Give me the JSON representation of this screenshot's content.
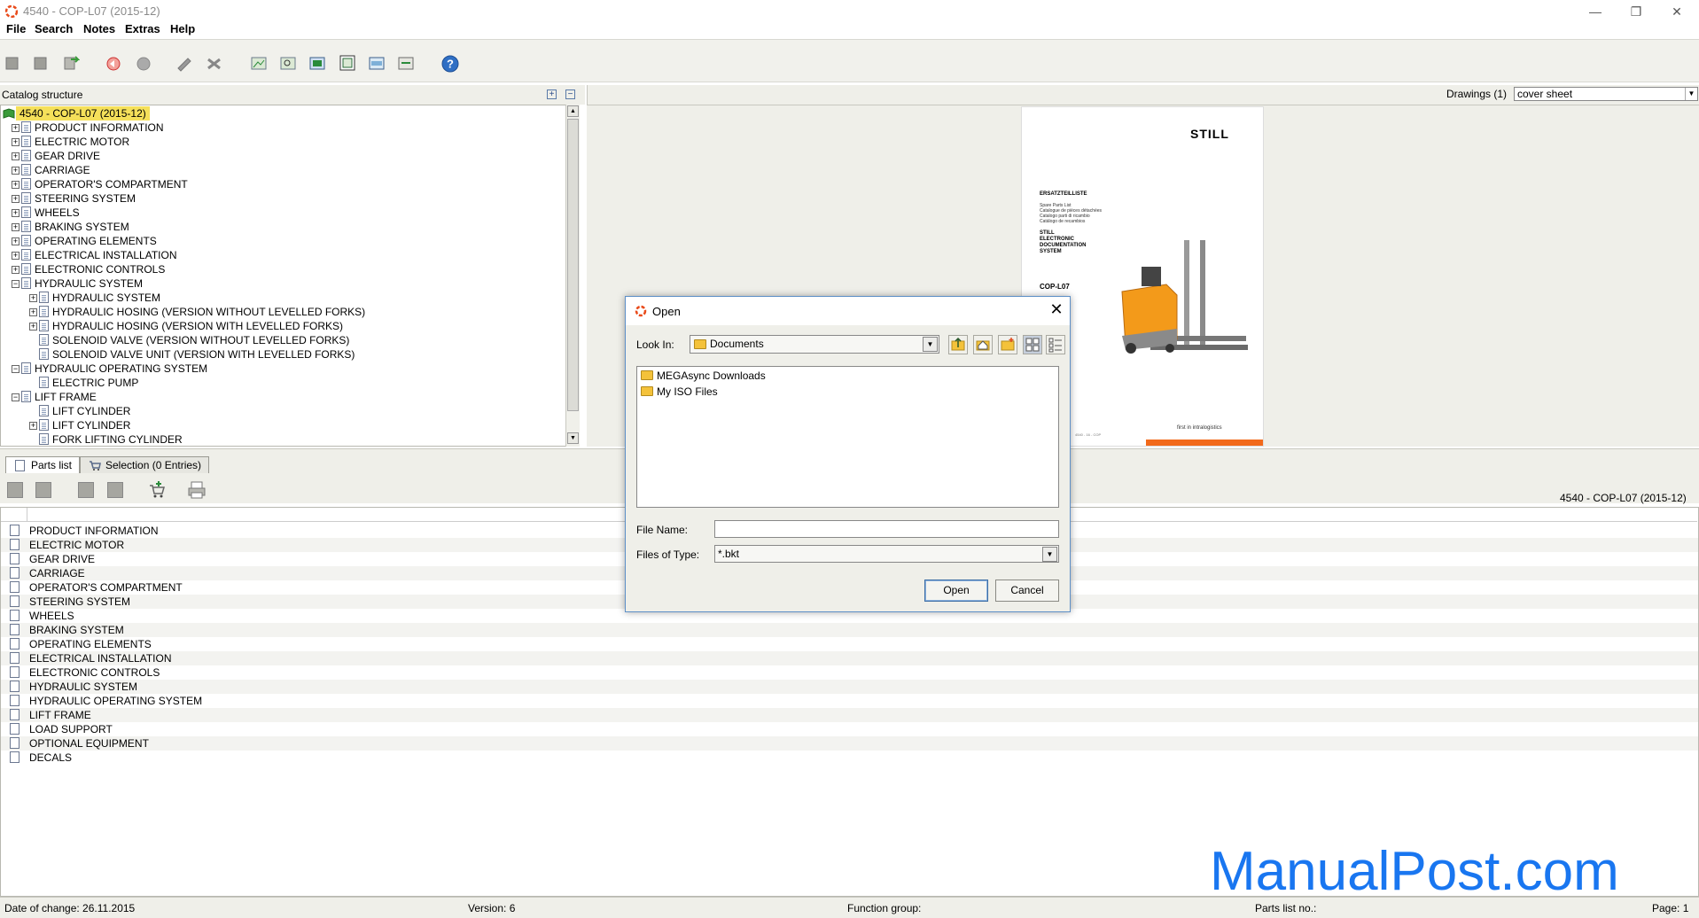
{
  "window": {
    "title": "4540 - COP-L07 (2015-12)",
    "minimize_glyph": "—",
    "restore_glyph": "❐",
    "close_glyph": "✕"
  },
  "menu": {
    "items": [
      "File",
      "Search",
      "Notes",
      "Extras",
      "Help"
    ]
  },
  "catalog": {
    "header_label": "Catalog structure",
    "root": "4540 - COP-L07 (2015-12)",
    "expand_all_glyph": "+",
    "collapse_all_glyph": "−",
    "items": [
      {
        "label": "PRODUCT INFORMATION",
        "level": 1,
        "expander": "+"
      },
      {
        "label": "ELECTRIC MOTOR",
        "level": 1,
        "expander": "+"
      },
      {
        "label": "GEAR DRIVE",
        "level": 1,
        "expander": "+"
      },
      {
        "label": "CARRIAGE",
        "level": 1,
        "expander": "+"
      },
      {
        "label": "OPERATOR'S COMPARTMENT",
        "level": 1,
        "expander": "+"
      },
      {
        "label": "STEERING SYSTEM",
        "level": 1,
        "expander": "+"
      },
      {
        "label": "WHEELS",
        "level": 1,
        "expander": "+"
      },
      {
        "label": "BRAKING SYSTEM",
        "level": 1,
        "expander": "+"
      },
      {
        "label": "OPERATING ELEMENTS",
        "level": 1,
        "expander": "+"
      },
      {
        "label": "ELECTRICAL INSTALLATION",
        "level": 1,
        "expander": "+"
      },
      {
        "label": "ELECTRONIC CONTROLS",
        "level": 1,
        "expander": "+"
      },
      {
        "label": "HYDRAULIC SYSTEM",
        "level": 1,
        "expander": "−"
      },
      {
        "label": "HYDRAULIC SYSTEM",
        "level": 2,
        "expander": "+"
      },
      {
        "label": "HYDRAULIC HOSING (VERSION WITHOUT LEVELLED FORKS)",
        "level": 2,
        "expander": "+"
      },
      {
        "label": "HYDRAULIC HOSING (VERSION WITH LEVELLED FORKS)",
        "level": 2,
        "expander": "+"
      },
      {
        "label": "SOLENOID VALVE (VERSION WITHOUT LEVELLED FORKS)",
        "level": 2,
        "expander": ""
      },
      {
        "label": "SOLENOID VALVE UNIT (VERSION WITH LEVELLED FORKS)",
        "level": 2,
        "expander": ""
      },
      {
        "label": "HYDRAULIC OPERATING SYSTEM",
        "level": 1,
        "expander": "−"
      },
      {
        "label": "ELECTRIC PUMP",
        "level": 2,
        "expander": ""
      },
      {
        "label": "LIFT FRAME",
        "level": 1,
        "expander": "−"
      },
      {
        "label": "LIFT CYLINDER",
        "level": 2,
        "expander": ""
      },
      {
        "label": "LIFT CYLINDER",
        "level": 2,
        "expander": "+"
      },
      {
        "label": "FORK LIFTING CYLINDER",
        "level": 2,
        "expander": ""
      }
    ]
  },
  "drawings": {
    "label": "Drawings (1)",
    "selected": "cover sheet",
    "cover": {
      "brand": "STILL",
      "heading": "ERSATZTEILLISTE",
      "subtitles": [
        "Spare Parts List",
        "Catalogue de pièces détachées",
        "Catalogo parti di ricambio",
        "Catálogo de recambios"
      ],
      "acronym": [
        "STILL",
        "ELECTRONIC",
        "DOCUMENTATION",
        "SYSTEM"
      ],
      "model": "COP-L07",
      "tagline": "first in intralogistics",
      "code": "4540 - 16 - COP"
    }
  },
  "tabs": [
    {
      "label": "Parts list",
      "active": true
    },
    {
      "label": "Selection (0 Entries)",
      "active": false
    }
  ],
  "parts": {
    "catalog_label": "4540 - COP-L07 (2015-12)",
    "rows": [
      "PRODUCT INFORMATION",
      "ELECTRIC MOTOR",
      "GEAR DRIVE",
      "CARRIAGE",
      "OPERATOR'S COMPARTMENT",
      "STEERING SYSTEM",
      "WHEELS",
      "BRAKING SYSTEM",
      "OPERATING ELEMENTS",
      "ELECTRICAL INSTALLATION",
      "ELECTRONIC CONTROLS",
      "HYDRAULIC SYSTEM",
      "HYDRAULIC OPERATING SYSTEM",
      "LIFT FRAME",
      "LOAD SUPPORT",
      "OPTIONAL EQUIPMENT",
      "DECALS"
    ]
  },
  "status": {
    "date": "Date of change: 26.11.2015",
    "version": "Version: 6",
    "function_group": "Function group:",
    "parts_list_no": "Parts list no.:",
    "page": "Page: 1"
  },
  "watermark": "ManualPost.com",
  "dialog": {
    "title": "Open",
    "close_glyph": "✕",
    "look_in_label": "Look In:",
    "look_in_value": "Documents",
    "files": [
      "MEGAsync Downloads",
      "My ISO Files"
    ],
    "file_name_label": "File Name:",
    "file_name_value": "",
    "files_of_type_label": "Files of Type:",
    "files_of_type_value": "*.bkt",
    "open_label": "Open",
    "cancel_label": "Cancel",
    "combo_arrow": "▼"
  },
  "colors": {
    "accent": "#f26a1b",
    "root_highlight": "#f5e05a",
    "watermark": "#1976f0",
    "dialog_border": "#5d8fc7"
  }
}
